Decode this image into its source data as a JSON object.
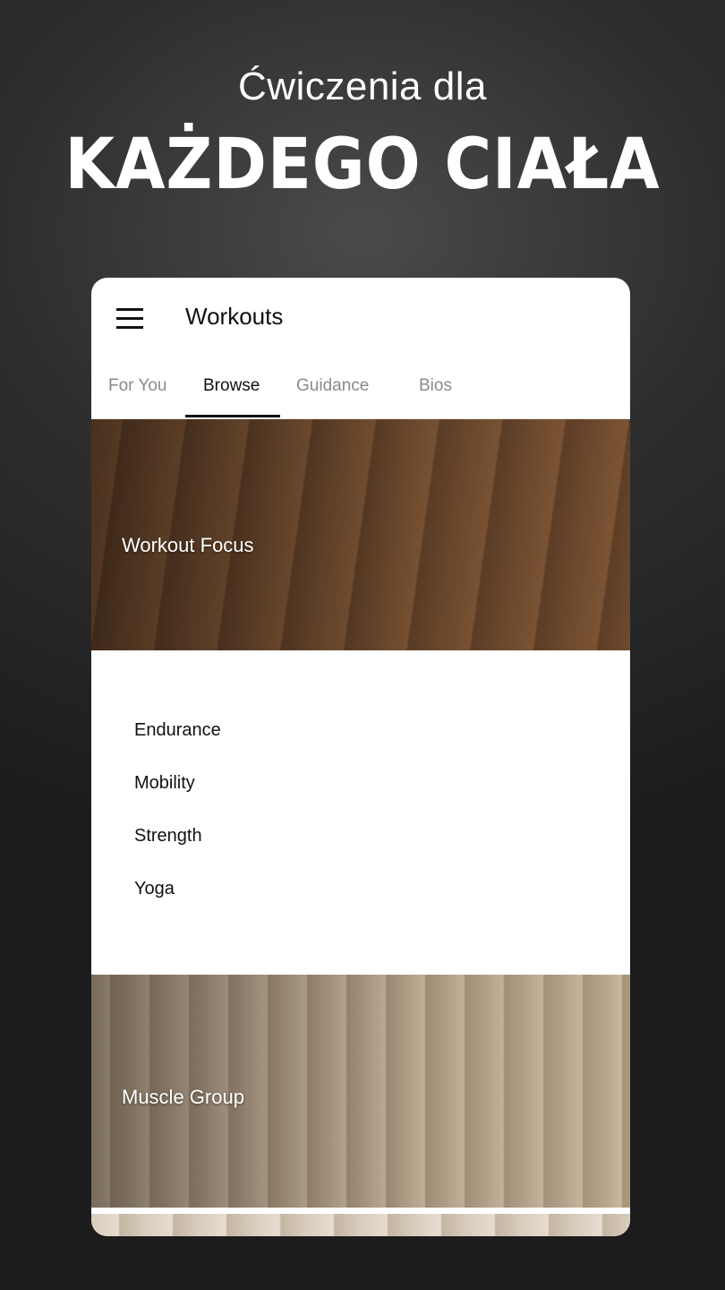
{
  "promo": {
    "subtitle": "Ćwiczenia dla",
    "headline": "KAŻDEGO CIAŁA"
  },
  "app_bar": {
    "menu_icon": "hamburger-menu-icon",
    "title": "Workouts"
  },
  "tabs": [
    {
      "label": "For You",
      "active": false
    },
    {
      "label": "Browse",
      "active": true
    },
    {
      "label": "Guidance",
      "active": false
    },
    {
      "label": "Bios",
      "active": false
    }
  ],
  "sections": {
    "workout_focus": {
      "label": "Workout Focus",
      "items": [
        "Endurance",
        "Mobility",
        "Strength",
        "Yoga"
      ]
    },
    "muscle_group": {
      "label": "Muscle Group"
    }
  },
  "colors": {
    "background": "#2e2e2e",
    "card": "#ffffff",
    "text_primary": "#111111",
    "tab_inactive": "#8a8a8a"
  }
}
